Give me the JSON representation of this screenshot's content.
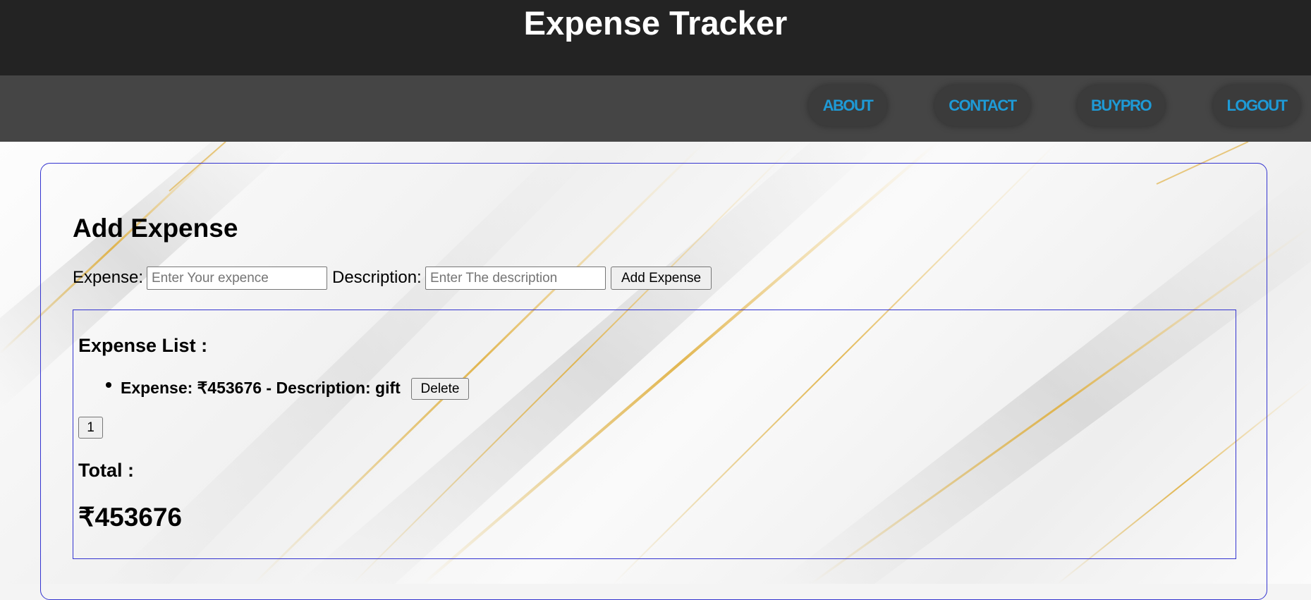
{
  "header": {
    "title": "Expense Tracker"
  },
  "nav": {
    "items": [
      {
        "label": "ABOUT"
      },
      {
        "label": "CONTACT"
      },
      {
        "label": "BUYPRO"
      },
      {
        "label": "LOGOUT"
      }
    ],
    "color": "#1e9ad6"
  },
  "form": {
    "heading": "Add Expense",
    "expense_label": "Expense:",
    "expense_placeholder": "Enter Your expence",
    "expense_value": "",
    "description_label": "Description:",
    "description_placeholder": "Enter The description",
    "description_value": "",
    "submit_label": "Add Expense"
  },
  "expense_list": {
    "heading": "Expense List :",
    "items": [
      {
        "text": "Expense: ₹453676 - Description: gift",
        "delete_label": "Delete"
      }
    ]
  },
  "pagination": {
    "pages": [
      "1"
    ]
  },
  "totals": {
    "label": "Total :",
    "value": "₹453676"
  },
  "colors": {
    "topbar": "#232323",
    "navbar": "#454545",
    "border_accent": "#3434d0"
  }
}
